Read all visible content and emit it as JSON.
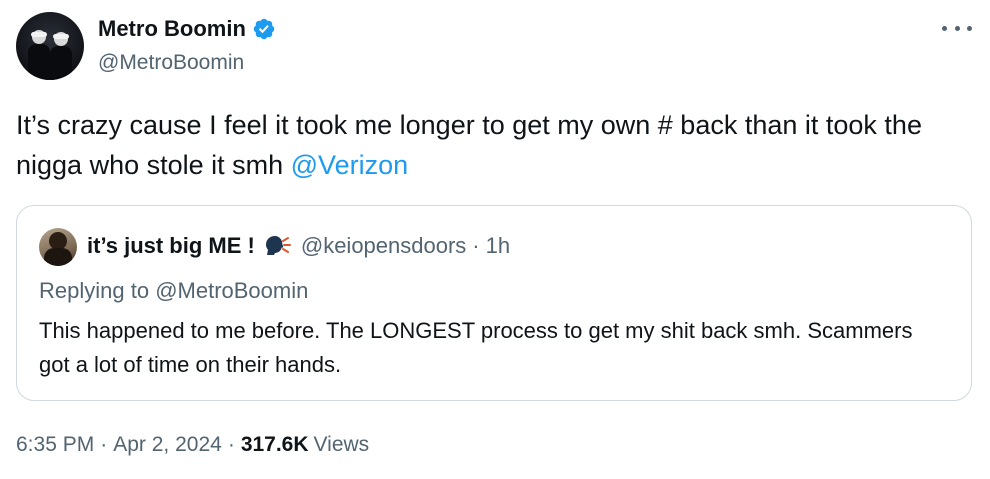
{
  "tweet": {
    "author": {
      "display_name": "Metro Boomin",
      "handle": "@MetroBoomin",
      "verified": true,
      "avatar_icon": "profile-photo"
    },
    "more_icon": "ellipsis-icon",
    "text_prefix": "It’s crazy cause I feel it took me longer to get my own # back than it took the nigga who stole it smh ",
    "text_mention": "@Verizon",
    "time": "6:35 PM",
    "date": "Apr 2, 2024",
    "views_count": "317.6K",
    "views_label": "Views",
    "separator": "·"
  },
  "quote": {
    "display_name": "it’s just big ME !",
    "emoji_icon": "speaking-head-icon",
    "handle": "@keiopensdoors",
    "separator": "·",
    "time": "1h",
    "replying_prefix": "Replying to ",
    "replying_to": "@MetroBoomin",
    "text": "This happened to me before. The LONGEST process to get my shit back smh. Scammers got a lot of time on their hands."
  },
  "colors": {
    "accent": "#1d9bf0",
    "secondary_text": "#536471",
    "border": "#cfd9de",
    "primary_text": "#0f1419"
  }
}
